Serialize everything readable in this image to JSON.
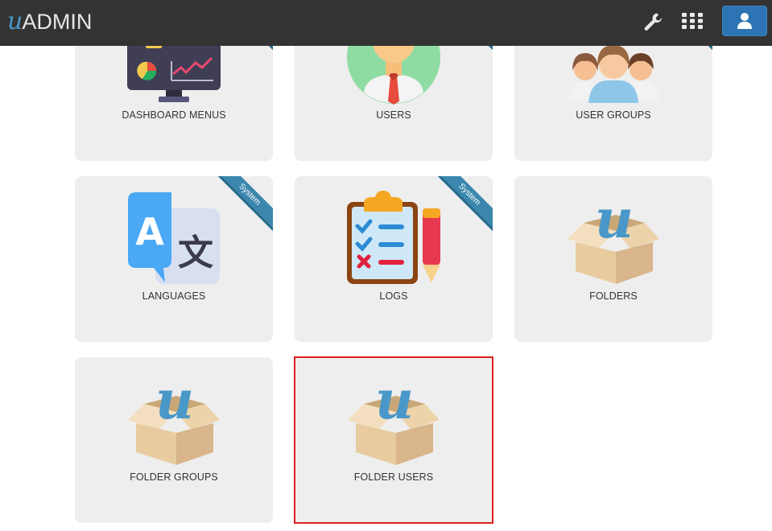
{
  "header": {
    "logo_u": "u",
    "logo_text": "ADMIN",
    "settings_icon": "wrench-icon",
    "apps_icon": "apps-grid-icon",
    "profile_icon": "user-icon"
  },
  "tiles": [
    {
      "label": "DASHBOARD MENUS",
      "icon": "dashboard-monitor-icon"
    },
    {
      "label": "USERS",
      "icon": "user-avatar-icon"
    },
    {
      "label": "USER GROUPS",
      "icon": "user-group-icon"
    },
    {
      "label": "LANGUAGES",
      "icon": "translate-icon",
      "ribbon": "System"
    },
    {
      "label": "LOGS",
      "icon": "clipboard-log-icon",
      "ribbon": "System"
    },
    {
      "label": "FOLDERS",
      "icon": "box-icon"
    },
    {
      "label": "FOLDER GROUPS",
      "icon": "box-icon"
    },
    {
      "label": "FOLDER USERS",
      "icon": "box-icon"
    }
  ],
  "colors": {
    "topbar": "#333333",
    "tile_bg": "#eeeeee",
    "ribbon": "#3b87ad",
    "profile_button": "#2c74b3",
    "selection_outline": "#e02020"
  }
}
